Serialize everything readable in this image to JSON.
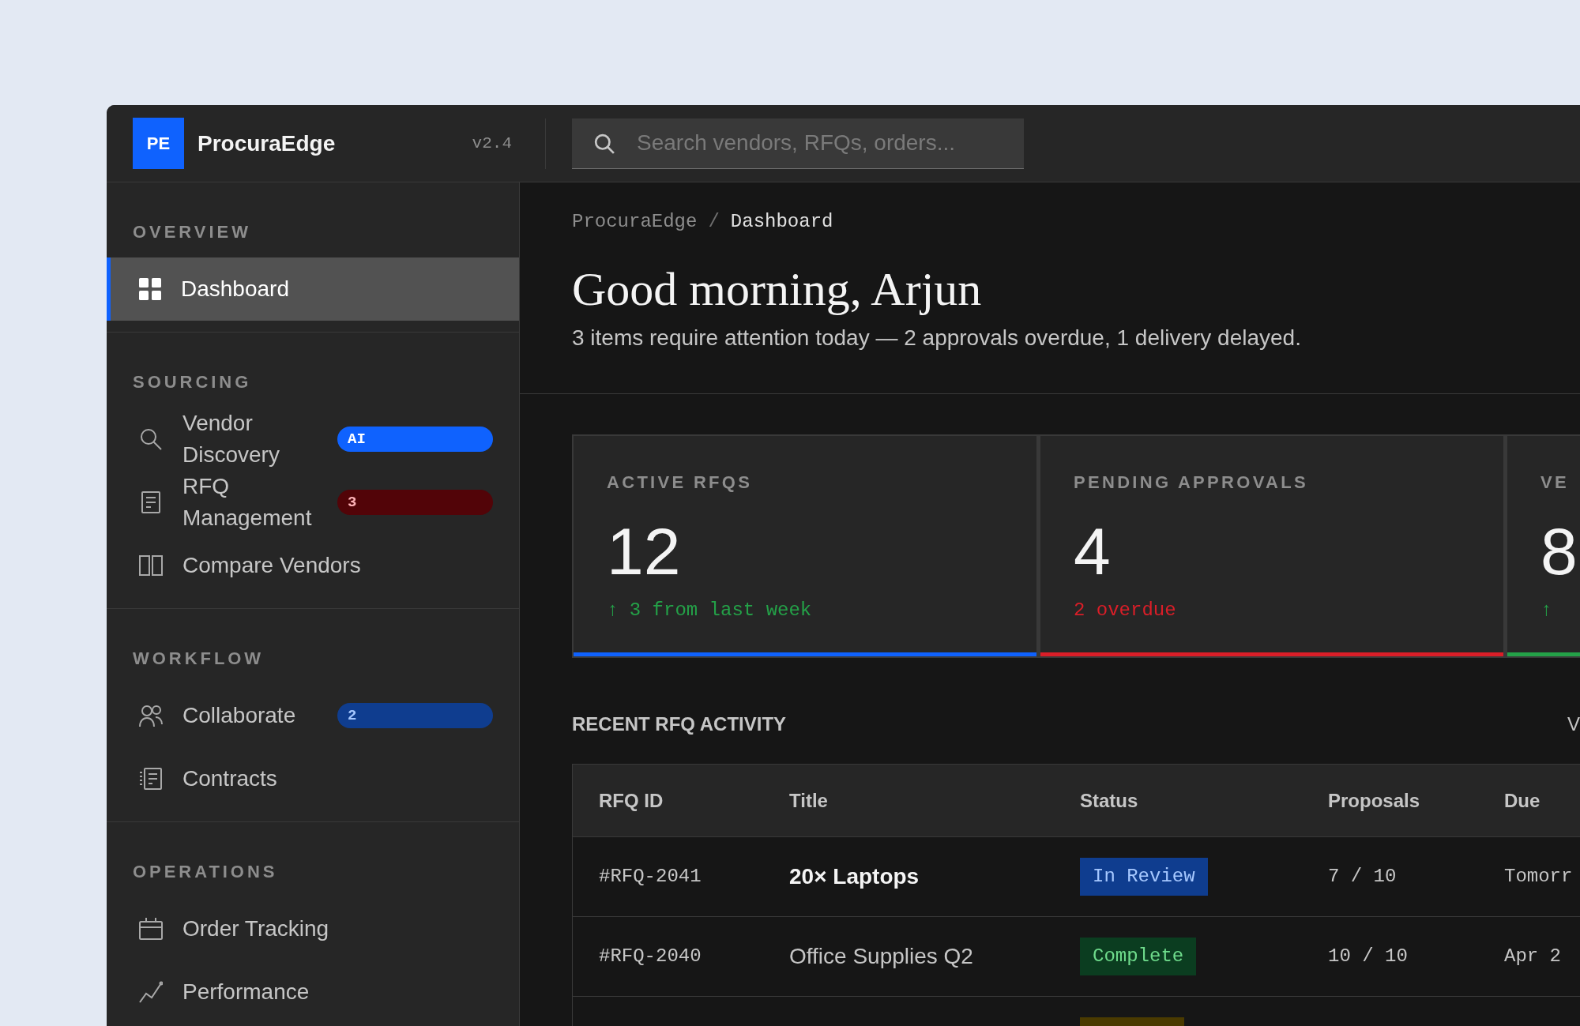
{
  "app": {
    "logo": "PE",
    "name": "ProcuraEdge",
    "version": "v2.4"
  },
  "search": {
    "placeholder": "Search vendors, RFQs, orders..."
  },
  "sidebar": {
    "sections": [
      {
        "title": "OVERVIEW",
        "items": [
          {
            "label": "Dashboard",
            "selected": true
          }
        ]
      },
      {
        "title": "SOURCING",
        "items": [
          {
            "label": "Vendor Discovery",
            "selected": false,
            "badge": {
              "text": "AI",
              "kind": "ai"
            }
          },
          {
            "label": "RFQ Management",
            "selected": false,
            "badge": {
              "text": "3",
              "kind": "alert"
            }
          },
          {
            "label": "Compare Vendors",
            "selected": false
          }
        ]
      },
      {
        "title": "WORKFLOW",
        "items": [
          {
            "label": "Collaborate",
            "selected": false,
            "badge": {
              "text": "2",
              "kind": "info"
            }
          },
          {
            "label": "Contracts",
            "selected": false
          }
        ]
      },
      {
        "title": "OPERATIONS",
        "items": [
          {
            "label": "Order Tracking",
            "selected": false
          },
          {
            "label": "Performance",
            "selected": false
          }
        ]
      }
    ]
  },
  "breadcrumb": {
    "separator": "/",
    "items": [
      {
        "label": "ProcuraEdge",
        "current": false
      },
      {
        "label": "Dashboard",
        "current": true
      }
    ]
  },
  "greeting": {
    "title": "Good morning, Arjun",
    "summary": "3 items require attention today — 2 approvals overdue, 1 delivery delayed."
  },
  "stats": [
    {
      "label": "ACTIVE RFQS",
      "value": "12",
      "delta": {
        "text": "↑ 3 from last week",
        "kind": "positive"
      },
      "color": "#0f62fe"
    },
    {
      "label": "PENDING APPROVALS",
      "value": "4",
      "delta": {
        "text": "2 overdue",
        "kind": "negative"
      },
      "color": "#da1e28"
    },
    {
      "label": "VE",
      "value": "8",
      "delta": {
        "text": "↑",
        "kind": "positive"
      },
      "color": "#24a148"
    }
  ],
  "recent_activity": {
    "title": "RECENT RFQ ACTIVITY",
    "link": "V",
    "table": {
      "columns": [
        "RFQ ID",
        "Title",
        "Status",
        "Proposals",
        "Due"
      ],
      "rows": [
        {
          "id": "#RFQ-2041",
          "title": "20× Laptops",
          "emphasized": true,
          "status": {
            "text": "In Review",
            "kind": "review"
          },
          "proposals": "7 / 10",
          "due": "Tomorr"
        },
        {
          "id": "#RFQ-2040",
          "title": "Office Supplies Q2",
          "emphasized": false,
          "status": {
            "text": "Complete",
            "kind": "complete"
          },
          "proposals": "10 / 10",
          "due": "Apr 2"
        },
        {
          "status": {
            "kind": "pending"
          }
        }
      ]
    }
  }
}
